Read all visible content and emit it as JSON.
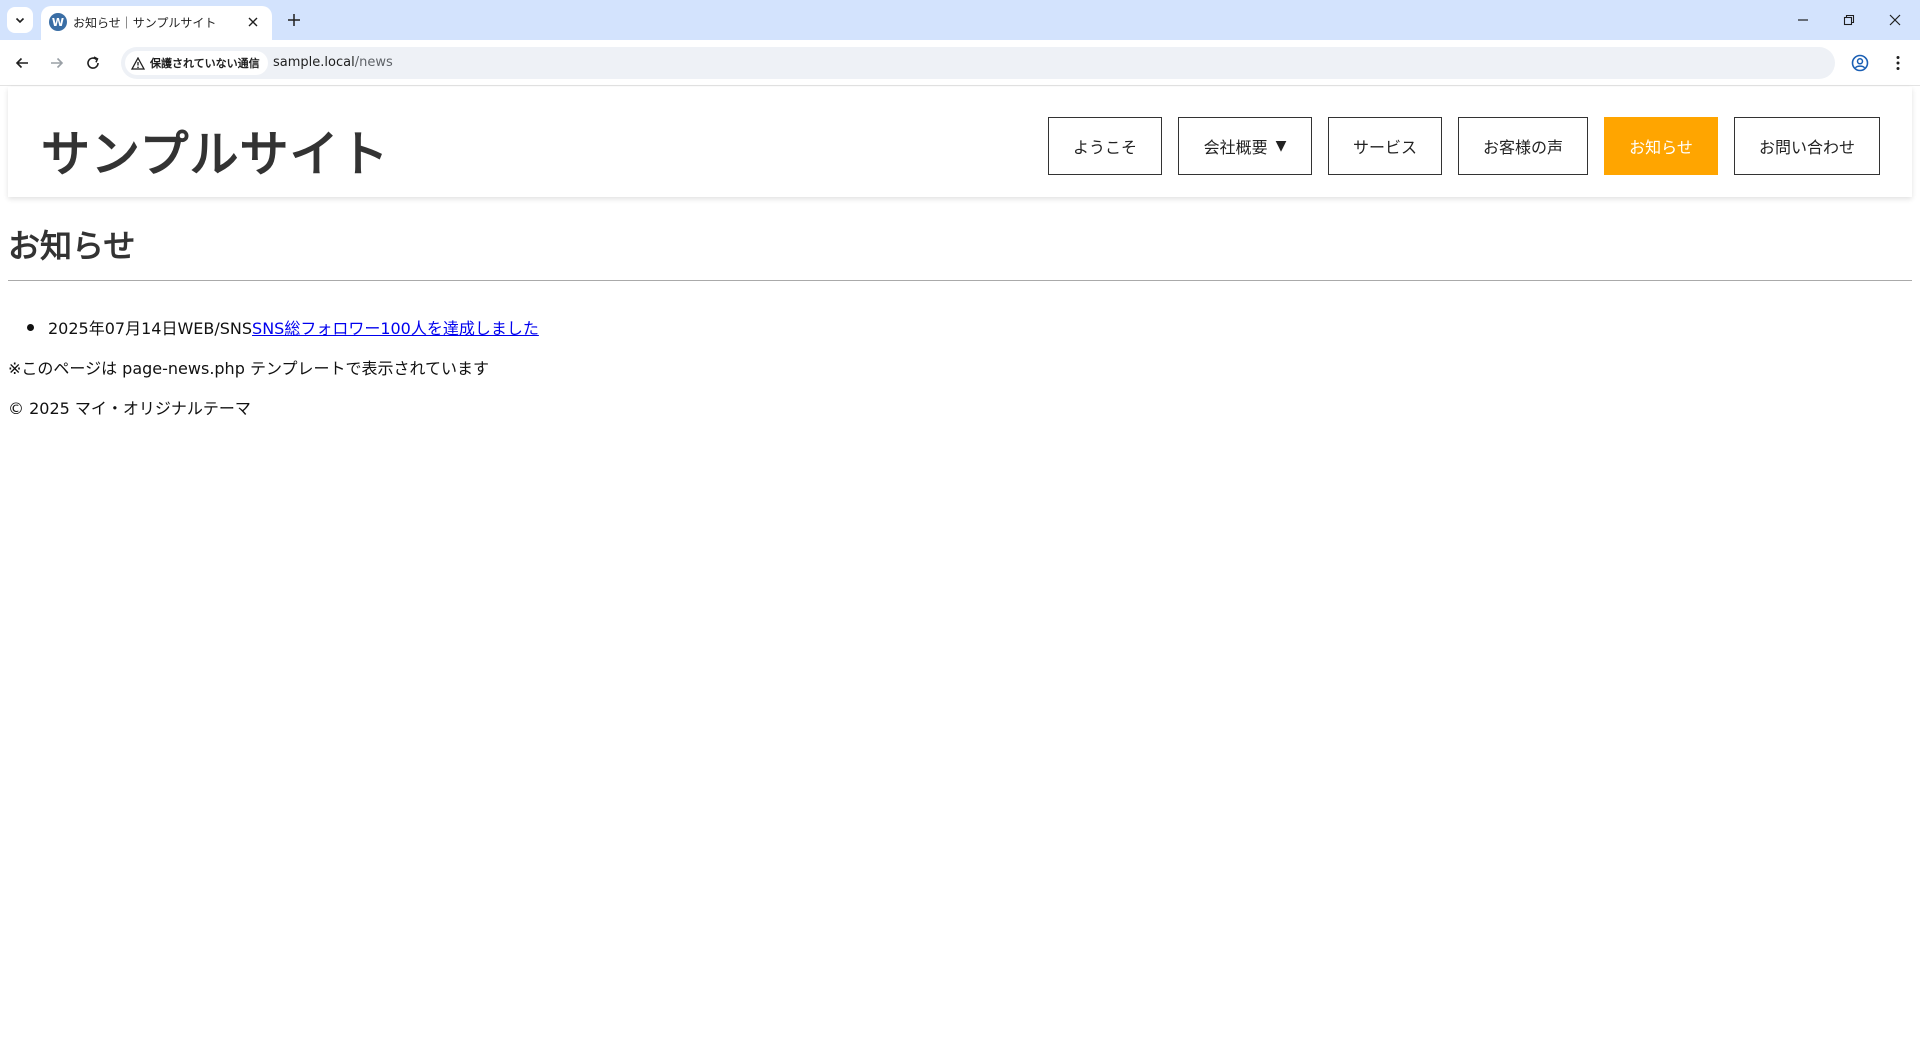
{
  "browser": {
    "tab": {
      "title": "お知らせ｜サンプルサイト",
      "favicon_icon": "wordpress-icon",
      "favicon_glyph": "W"
    },
    "address_bar": {
      "security_label": "保護されていない通信",
      "url_host": "sample.local",
      "url_path": "/news"
    },
    "icons": [
      "tab-search-icon",
      "close-icon",
      "plus-icon",
      "minimize-icon",
      "restore-icon",
      "close-window-icon",
      "back-icon",
      "forward-icon",
      "reload-icon",
      "warning-icon",
      "star-icon",
      "profile-icon",
      "kebab-menu-icon"
    ]
  },
  "site": {
    "title": "サンプルサイト",
    "nav": [
      {
        "label": "ようこそ",
        "active": false
      },
      {
        "label": "会社概要",
        "active": false,
        "has_dropdown": true,
        "caret": "▼"
      },
      {
        "label": "サービス",
        "active": false
      },
      {
        "label": "お客様の声",
        "active": false
      },
      {
        "label": "お知らせ",
        "active": true
      },
      {
        "label": "お問い合わせ",
        "active": false
      }
    ],
    "accent_color": "#ffa500"
  },
  "page": {
    "heading": "お知らせ",
    "news": [
      {
        "date": "2025年07月14日",
        "category": "WEB/SNS",
        "title": "SNS総フォロワー100人を達成しました"
      }
    ],
    "template_note": "※このページは page-news.php テンプレートで表示されています",
    "copyright": "© 2025 マイ・オリジナルテーマ"
  }
}
